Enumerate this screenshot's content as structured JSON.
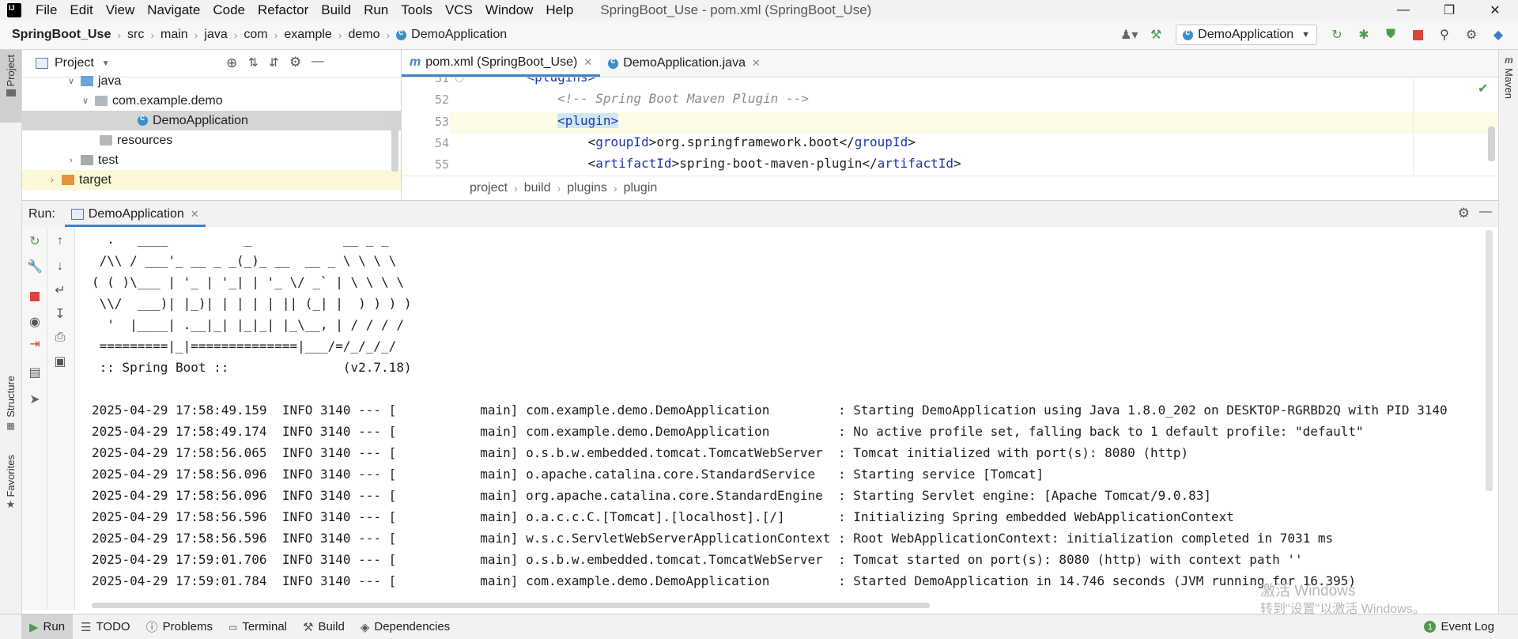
{
  "window": {
    "title": "SpringBoot_Use - pom.xml (SpringBoot_Use)",
    "menu": [
      "File",
      "Edit",
      "View",
      "Navigate",
      "Code",
      "Refactor",
      "Build",
      "Run",
      "Tools",
      "VCS",
      "Window",
      "Help"
    ]
  },
  "breadcrumb": {
    "project": "SpringBoot_Use",
    "parts": [
      "src",
      "main",
      "java",
      "com",
      "example",
      "demo"
    ],
    "current": "DemoApplication"
  },
  "toolbar": {
    "run_config": "DemoApplication"
  },
  "sidebar": {
    "left_tabs": [
      "Project",
      "Structure",
      "Favorites"
    ],
    "right_tabs": [
      "Maven"
    ]
  },
  "project_panel": {
    "title": "Project",
    "tree": [
      {
        "label": "java",
        "expanded": true
      },
      {
        "label": "com.example.demo",
        "expanded": true
      },
      {
        "label": "DemoApplication",
        "selected": true
      },
      {
        "label": "resources"
      },
      {
        "label": "test",
        "expanded": false
      },
      {
        "label": "target",
        "expanded": false
      }
    ]
  },
  "editor": {
    "tabs": [
      {
        "label": "pom.xml (SpringBoot_Use)",
        "active": true
      },
      {
        "label": "DemoApplication.java",
        "active": false
      }
    ],
    "line_numbers": [
      "51",
      "52",
      "53",
      "54",
      "55"
    ],
    "lines": [
      {
        "indent": "    ",
        "pre": "<",
        "tag": "plugins",
        "mid": ">",
        "text": "",
        "closetag": "",
        "post": ""
      },
      {
        "indent": "        ",
        "comment": "<!-- Spring Boot Maven Plugin -->"
      },
      {
        "indent": "        ",
        "pre": "<",
        "tag": "plugin",
        "mid": ">",
        "text": "",
        "closetag": "",
        "post": ""
      },
      {
        "indent": "            ",
        "pre": "<",
        "tag": "groupId",
        "mid": ">",
        "text": "org.springframework.boot",
        "closetag": "groupId",
        "post": ""
      },
      {
        "indent": "            ",
        "pre": "<",
        "tag": "artifactId",
        "mid": ">",
        "text": "spring-boot-maven-plugin",
        "closetag": "artifactId",
        "post": ""
      }
    ],
    "breadcrumb": [
      "project",
      "build",
      "plugins",
      "plugin"
    ]
  },
  "run_panel": {
    "label": "Run:",
    "tab": "DemoApplication",
    "console_lines": [
      "  .   ____          _            __ _ _",
      " /\\\\ / ___'_ __ _ _(_)_ __  __ _ \\ \\ \\ \\",
      "( ( )\\___ | '_ | '_| | '_ \\/ _` | \\ \\ \\ \\",
      " \\\\/  ___)| |_)| | | | | || (_| |  ) ) ) )",
      "  '  |____| .__|_| |_|_| |_\\__, | / / / /",
      " =========|_|==============|___/=/_/_/_/",
      " :: Spring Boot ::               (v2.7.18)",
      "",
      "2025-04-29 17:58:49.159  INFO 3140 --- [           main] com.example.demo.DemoApplication         : Starting DemoApplication using Java 1.8.0_202 on DESKTOP-RGRBD2Q with PID 3140",
      "2025-04-29 17:58:49.174  INFO 3140 --- [           main] com.example.demo.DemoApplication         : No active profile set, falling back to 1 default profile: \"default\"",
      "2025-04-29 17:58:56.065  INFO 3140 --- [           main] o.s.b.w.embedded.tomcat.TomcatWebServer  : Tomcat initialized with port(s): 8080 (http)",
      "2025-04-29 17:58:56.096  INFO 3140 --- [           main] o.apache.catalina.core.StandardService   : Starting service [Tomcat]",
      "2025-04-29 17:58:56.096  INFO 3140 --- [           main] org.apache.catalina.core.StandardEngine  : Starting Servlet engine: [Apache Tomcat/9.0.83]",
      "2025-04-29 17:58:56.596  INFO 3140 --- [           main] o.a.c.c.C.[Tomcat].[localhost].[/]       : Initializing Spring embedded WebApplicationContext",
      "2025-04-29 17:58:56.596  INFO 3140 --- [           main] w.s.c.ServletWebServerApplicationContext : Root WebApplicationContext: initialization completed in 7031 ms",
      "2025-04-29 17:59:01.706  INFO 3140 --- [           main] o.s.b.w.embedded.tomcat.TomcatWebServer  : Tomcat started on port(s): 8080 (http) with context path ''",
      "2025-04-29 17:59:01.784  INFO 3140 --- [           main] com.example.demo.DemoApplication         : Started DemoApplication in 14.746 seconds (JVM running for 16.395)"
    ]
  },
  "bottom_bar": {
    "items": [
      "Run",
      "TODO",
      "Problems",
      "Terminal",
      "Build",
      "Dependencies"
    ],
    "active": "Run",
    "event_log": "Event Log",
    "event_count": "1"
  },
  "watermark": {
    "line1": "激活 Windows",
    "line2": "转到\"设置\"以激活 Windows。"
  },
  "colors": {
    "accent": "#4083c9",
    "run_green": "#4e9a4e",
    "stop_red": "#d9443b"
  }
}
